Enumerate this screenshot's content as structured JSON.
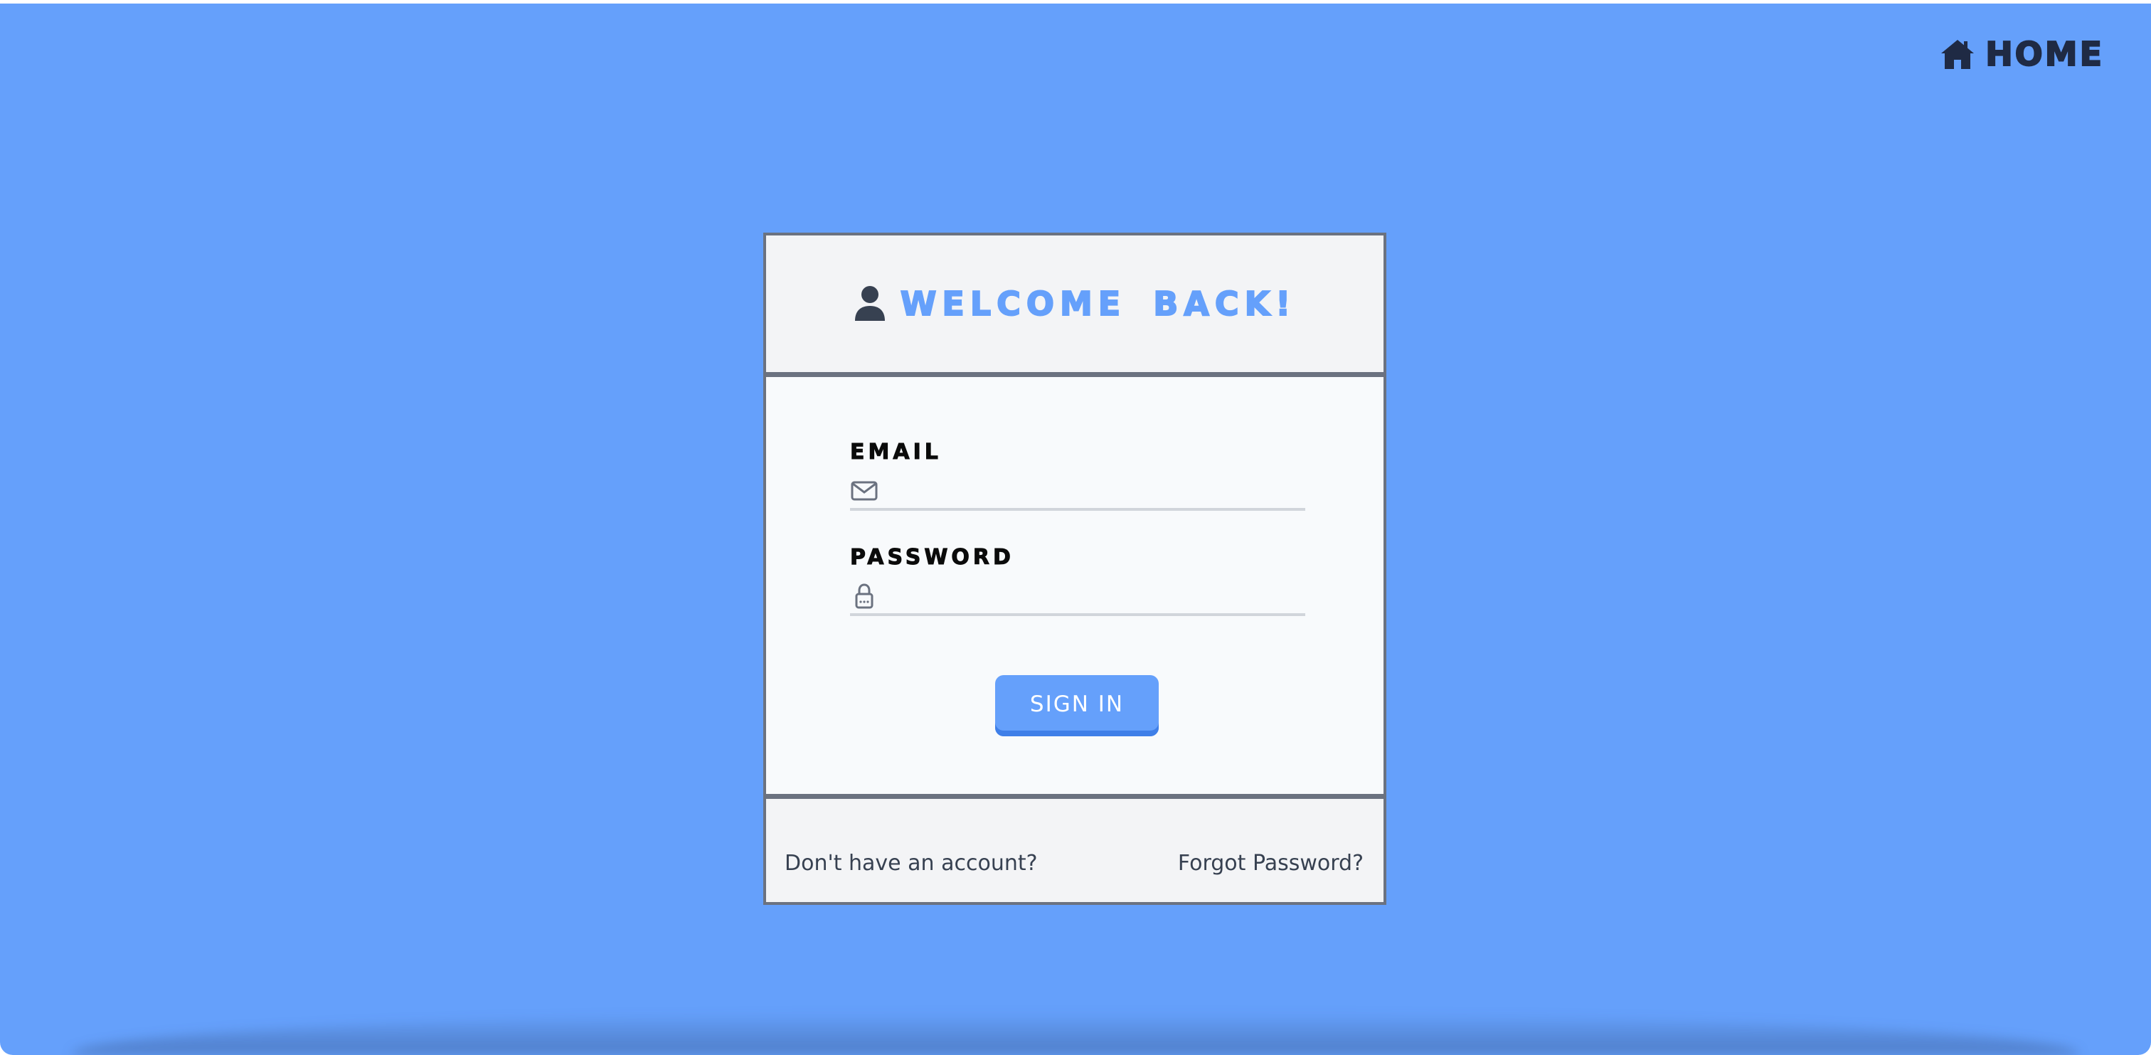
{
  "nav": {
    "home_label": "HOME",
    "home_icon": "home-icon"
  },
  "login": {
    "title": "WELCOME BACK!",
    "title_icon": "user-icon",
    "email": {
      "label": "EMAIL",
      "icon": "envelope-icon",
      "value": "",
      "placeholder": ""
    },
    "password": {
      "label": "PASSWORD",
      "icon": "lock-icon",
      "value": "",
      "placeholder": ""
    },
    "submit_label": "SIGN IN"
  },
  "footer": {
    "signup_link": "Don't have an account?",
    "forgot_link": "Forgot Password?"
  },
  "colors": {
    "background": "#65a0fb",
    "accent": "#65a0fb",
    "card_border": "#6b7280",
    "card_header_bg": "#f3f4f6",
    "card_body_bg": "#f8fafc",
    "text_dark": "#1f2a44",
    "link_text": "#374151"
  }
}
